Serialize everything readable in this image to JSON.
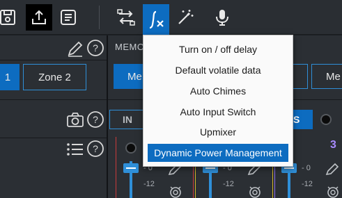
{
  "toolbar": {
    "buttons": [
      {
        "name": "save-icon"
      },
      {
        "name": "upload-icon"
      },
      {
        "name": "notes-list-icon"
      },
      {
        "name": "routing-icon"
      },
      {
        "name": "function-icon"
      },
      {
        "name": "magic-wand-icon"
      },
      {
        "name": "microphone-icon"
      }
    ]
  },
  "left_panel": {
    "zone_buttons": [
      "1",
      "Zone 2"
    ]
  },
  "right_panel": {
    "memory_label": "MEMO",
    "memory_buttons": [
      "Me",
      "Me"
    ],
    "input_label": "IN",
    "s_label": "S",
    "channel_number": "3",
    "scale_labels": [
      "- 0",
      "-12",
      "- 0",
      "-12",
      "- 0",
      "-12"
    ]
  },
  "colors": {
    "accent": "#0d6cc0",
    "accent_light": "#2f8fd8",
    "strip_red": "#c83a3a",
    "strip_yellow": "#d4b62a",
    "strip_purple": "#8a6df0"
  },
  "function_menu": {
    "items": [
      "Turn on / off delay",
      "Default volatile data",
      "Auto Chimes",
      "Auto Input Switch",
      "Upmixer",
      "Dynamic Power Management"
    ],
    "highlighted_index": 5
  }
}
